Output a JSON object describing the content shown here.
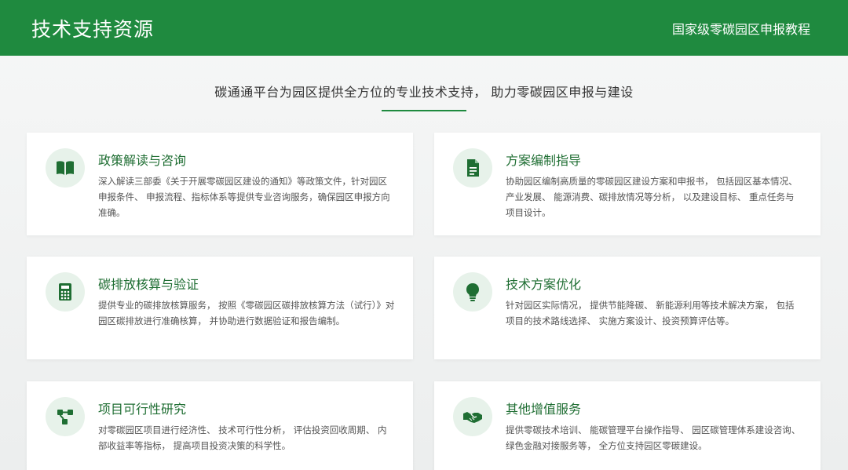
{
  "header": {
    "title": "技术支持资源",
    "subtitle": "国家级零碳园区申报教程"
  },
  "intro": "碳通通平台为园区提供全方位的专业技术支持， 助力零碳园区申报与建设",
  "colors": {
    "brand": "#1f8a3f",
    "title_text": "#1f6e33",
    "icon_bg": "#e7f2ea"
  },
  "cards": [
    {
      "icon": "book-icon",
      "title": "政策解读与咨询",
      "desc": "深入解读三部委《关于开展零碳园区建设的通知》等政策文件，针对园区申报条件、 申报流程、指标体系等提供专业咨询服务，确保园区申报方向准确。"
    },
    {
      "icon": "document-icon",
      "title": "方案编制指导",
      "desc": "协助园区编制高质量的零碳园区建设方案和申报书， 包括园区基本情况、产业发展、 能源消费、碳排放情况等分析， 以及建设目标、 重点任务与项目设计。"
    },
    {
      "icon": "calculator-icon",
      "title": "碳排放核算与验证",
      "desc": "提供专业的碳排放核算服务， 按照《零碳园区碳排放核算方法（试行）》对园区碳排放进行准确核算， 并协助进行数据验证和报告编制。"
    },
    {
      "icon": "lightbulb-icon",
      "title": "技术方案优化",
      "desc": "针对园区实际情况， 提供节能降碳、 新能源利用等技术解决方案， 包括项目的技术路线选择、 实施方案设计、投资预算评估等。"
    },
    {
      "icon": "project-diagram-icon",
      "title": "项目可行性研究",
      "desc": "对零碳园区项目进行经济性、 技术可行性分析， 评估投资回收周期、 内部收益率等指标， 提高项目投资决策的科学性。"
    },
    {
      "icon": "handshake-icon",
      "title": "其他增值服务",
      "desc": "提供零碳技术培训、 能碳管理平台操作指导、 园区碳管理体系建设咨询、 绿色金融对接服务等， 全方位支持园区零碳建设。"
    }
  ]
}
